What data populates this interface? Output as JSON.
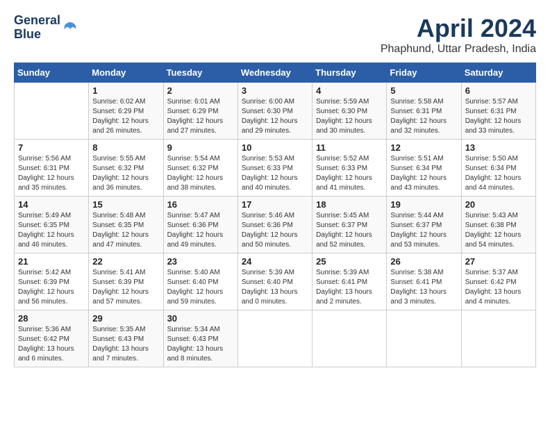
{
  "header": {
    "logo_line1": "General",
    "logo_line2": "Blue",
    "month": "April 2024",
    "location": "Phaphund, Uttar Pradesh, India"
  },
  "weekdays": [
    "Sunday",
    "Monday",
    "Tuesday",
    "Wednesday",
    "Thursday",
    "Friday",
    "Saturday"
  ],
  "weeks": [
    [
      {
        "day": "",
        "info": ""
      },
      {
        "day": "1",
        "info": "Sunrise: 6:02 AM\nSunset: 6:29 PM\nDaylight: 12 hours\nand 26 minutes."
      },
      {
        "day": "2",
        "info": "Sunrise: 6:01 AM\nSunset: 6:29 PM\nDaylight: 12 hours\nand 27 minutes."
      },
      {
        "day": "3",
        "info": "Sunrise: 6:00 AM\nSunset: 6:30 PM\nDaylight: 12 hours\nand 29 minutes."
      },
      {
        "day": "4",
        "info": "Sunrise: 5:59 AM\nSunset: 6:30 PM\nDaylight: 12 hours\nand 30 minutes."
      },
      {
        "day": "5",
        "info": "Sunrise: 5:58 AM\nSunset: 6:31 PM\nDaylight: 12 hours\nand 32 minutes."
      },
      {
        "day": "6",
        "info": "Sunrise: 5:57 AM\nSunset: 6:31 PM\nDaylight: 12 hours\nand 33 minutes."
      }
    ],
    [
      {
        "day": "7",
        "info": "Sunrise: 5:56 AM\nSunset: 6:31 PM\nDaylight: 12 hours\nand 35 minutes."
      },
      {
        "day": "8",
        "info": "Sunrise: 5:55 AM\nSunset: 6:32 PM\nDaylight: 12 hours\nand 36 minutes."
      },
      {
        "day": "9",
        "info": "Sunrise: 5:54 AM\nSunset: 6:32 PM\nDaylight: 12 hours\nand 38 minutes."
      },
      {
        "day": "10",
        "info": "Sunrise: 5:53 AM\nSunset: 6:33 PM\nDaylight: 12 hours\nand 40 minutes."
      },
      {
        "day": "11",
        "info": "Sunrise: 5:52 AM\nSunset: 6:33 PM\nDaylight: 12 hours\nand 41 minutes."
      },
      {
        "day": "12",
        "info": "Sunrise: 5:51 AM\nSunset: 6:34 PM\nDaylight: 12 hours\nand 43 minutes."
      },
      {
        "day": "13",
        "info": "Sunrise: 5:50 AM\nSunset: 6:34 PM\nDaylight: 12 hours\nand 44 minutes."
      }
    ],
    [
      {
        "day": "14",
        "info": "Sunrise: 5:49 AM\nSunset: 6:35 PM\nDaylight: 12 hours\nand 46 minutes."
      },
      {
        "day": "15",
        "info": "Sunrise: 5:48 AM\nSunset: 6:35 PM\nDaylight: 12 hours\nand 47 minutes."
      },
      {
        "day": "16",
        "info": "Sunrise: 5:47 AM\nSunset: 6:36 PM\nDaylight: 12 hours\nand 49 minutes."
      },
      {
        "day": "17",
        "info": "Sunrise: 5:46 AM\nSunset: 6:36 PM\nDaylight: 12 hours\nand 50 minutes."
      },
      {
        "day": "18",
        "info": "Sunrise: 5:45 AM\nSunset: 6:37 PM\nDaylight: 12 hours\nand 52 minutes."
      },
      {
        "day": "19",
        "info": "Sunrise: 5:44 AM\nSunset: 6:37 PM\nDaylight: 12 hours\nand 53 minutes."
      },
      {
        "day": "20",
        "info": "Sunrise: 5:43 AM\nSunset: 6:38 PM\nDaylight: 12 hours\nand 54 minutes."
      }
    ],
    [
      {
        "day": "21",
        "info": "Sunrise: 5:42 AM\nSunset: 6:39 PM\nDaylight: 12 hours\nand 56 minutes."
      },
      {
        "day": "22",
        "info": "Sunrise: 5:41 AM\nSunset: 6:39 PM\nDaylight: 12 hours\nand 57 minutes."
      },
      {
        "day": "23",
        "info": "Sunrise: 5:40 AM\nSunset: 6:40 PM\nDaylight: 12 hours\nand 59 minutes."
      },
      {
        "day": "24",
        "info": "Sunrise: 5:39 AM\nSunset: 6:40 PM\nDaylight: 13 hours\nand 0 minutes."
      },
      {
        "day": "25",
        "info": "Sunrise: 5:39 AM\nSunset: 6:41 PM\nDaylight: 13 hours\nand 2 minutes."
      },
      {
        "day": "26",
        "info": "Sunrise: 5:38 AM\nSunset: 6:41 PM\nDaylight: 13 hours\nand 3 minutes."
      },
      {
        "day": "27",
        "info": "Sunrise: 5:37 AM\nSunset: 6:42 PM\nDaylight: 13 hours\nand 4 minutes."
      }
    ],
    [
      {
        "day": "28",
        "info": "Sunrise: 5:36 AM\nSunset: 6:42 PM\nDaylight: 13 hours\nand 6 minutes."
      },
      {
        "day": "29",
        "info": "Sunrise: 5:35 AM\nSunset: 6:43 PM\nDaylight: 13 hours\nand 7 minutes."
      },
      {
        "day": "30",
        "info": "Sunrise: 5:34 AM\nSunset: 6:43 PM\nDaylight: 13 hours\nand 8 minutes."
      },
      {
        "day": "",
        "info": ""
      },
      {
        "day": "",
        "info": ""
      },
      {
        "day": "",
        "info": ""
      },
      {
        "day": "",
        "info": ""
      }
    ]
  ]
}
